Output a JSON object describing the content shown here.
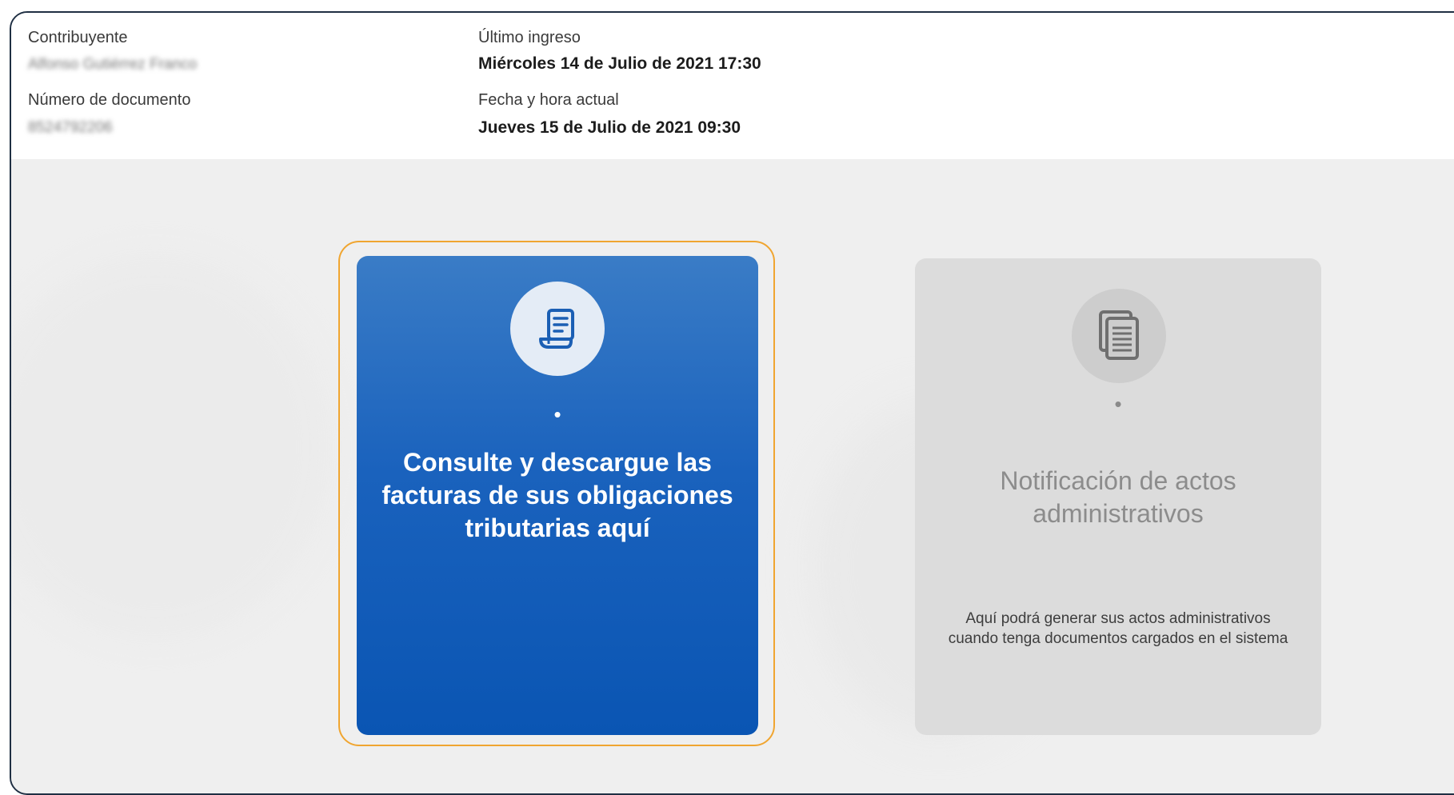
{
  "header": {
    "taxpayer": {
      "label": "Contribuyente",
      "value": "Alfonso Gutiérrez Franco"
    },
    "document_number": {
      "label": "Número de documento",
      "value": "8524792206"
    },
    "last_login": {
      "label": "Último ingreso",
      "value": "Miércoles 14 de Julio de 2021 17:30"
    },
    "current_datetime": {
      "label": "Fecha y hora actual",
      "value": "Jueves 15 de Julio de 2021 09:30"
    }
  },
  "cards": {
    "invoices": {
      "icon": "receipt-scroll-icon",
      "dot": "•",
      "title": "Consulte y descargue las facturas de sus obligaciones tributarias aquí",
      "state": "active"
    },
    "notifications": {
      "icon": "documents-icon",
      "dot": "•",
      "title": "Notificación de actos administrativos",
      "description": "Aquí podrá generar sus actos administrativos cuando tenga documentos cargados en el sistema",
      "state": "disabled"
    }
  },
  "colors": {
    "card_active": "#1a62bd",
    "card_disabled": "#dcdcdc",
    "highlight_border": "#f0a530",
    "frame_border": "#1f2f43"
  }
}
